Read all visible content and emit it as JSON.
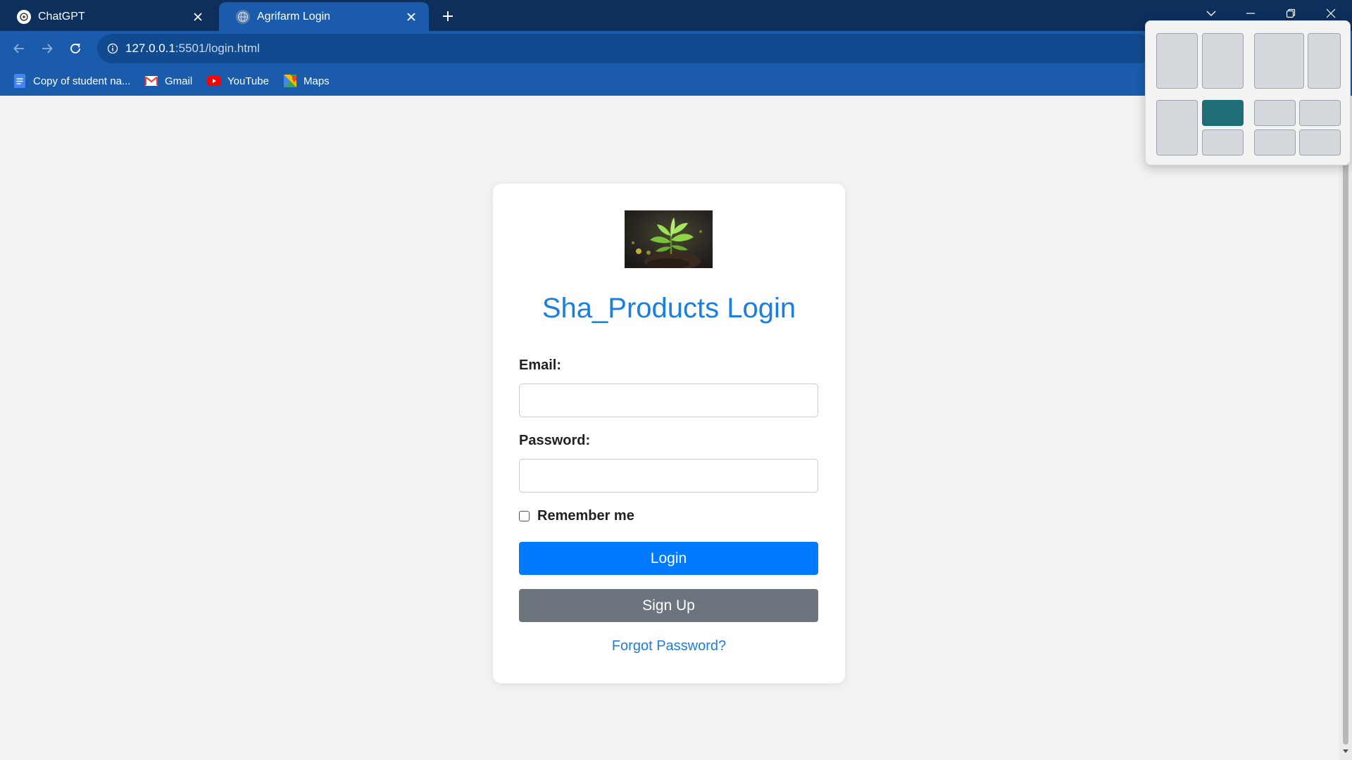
{
  "browser": {
    "tabs": [
      {
        "title": "ChatGPT",
        "icon": "chatgpt-icon",
        "active": false
      },
      {
        "title": "Agrifarm Login",
        "icon": "globe-icon",
        "active": true
      }
    ],
    "address": {
      "host": "127.0.0.1",
      "rest": ":5501/login.html"
    },
    "bookmarks": [
      {
        "label": "Copy of student na...",
        "icon": "docs-icon"
      },
      {
        "label": "Gmail",
        "icon": "gmail-icon"
      },
      {
        "label": "YouTube",
        "icon": "youtube-icon"
      },
      {
        "label": "Maps",
        "icon": "maps-icon"
      }
    ]
  },
  "login": {
    "title": "Sha_Products Login",
    "email_label": "Email:",
    "email_value": "",
    "password_label": "Password:",
    "password_value": "",
    "remember_label": "Remember me",
    "remember_checked": false,
    "login_button": "Login",
    "signup_button": "Sign Up",
    "forgot_link": "Forgot Password?"
  },
  "colors": {
    "tabbar": "#0d2f5c",
    "toolbar": "#1a5cab",
    "title": "#1a7fe0",
    "login_button": "#007bff",
    "signup_button": "#6c757d",
    "snap_highlight": "#1e6e78"
  }
}
